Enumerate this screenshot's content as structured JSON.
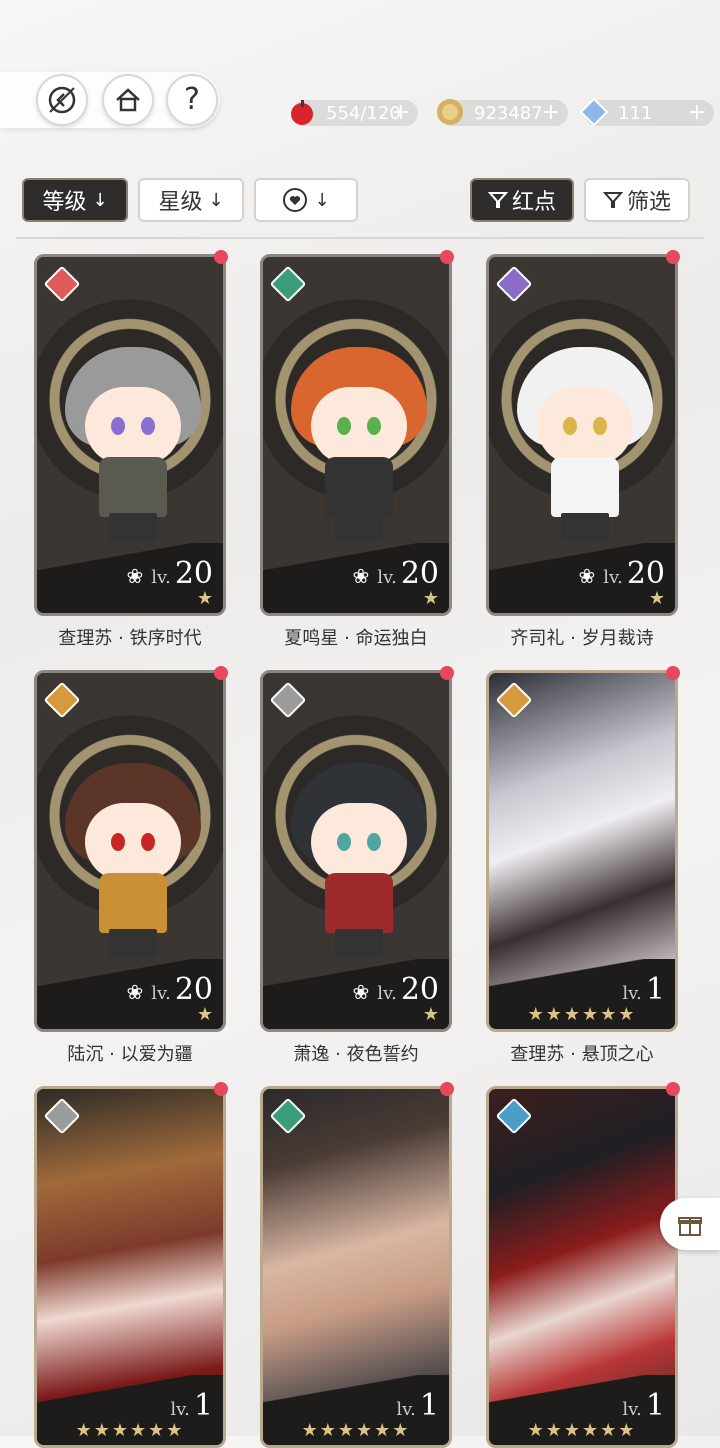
{
  "resources": [
    {
      "icon": "apple-icon",
      "value": "554/120",
      "plus": "+"
    },
    {
      "icon": "coin-icon",
      "value": "923487",
      "plus": "+"
    },
    {
      "icon": "diamond-icon",
      "value": "111",
      "plus": "+"
    }
  ],
  "top_buttons": {
    "help": "?"
  },
  "filters": {
    "level": "等级",
    "star": "星级",
    "affinity_arrow": "↓",
    "level_arrow": "↓",
    "star_arrow": "↓",
    "red_dot": "红点",
    "screen": "筛选"
  },
  "cards": [
    {
      "name": "查理苏 · 铁序时代",
      "lv_label": "lv.",
      "level": "20",
      "stars": "★",
      "element": "#e05a5a",
      "hair": "#9a9a9a",
      "eye": "#8b6fd0",
      "outfit": "#5a5a50"
    },
    {
      "name": "夏鸣星 · 命运独白",
      "lv_label": "lv.",
      "level": "20",
      "stars": "★",
      "element": "#3a9c7a",
      "hair": "#d9652f",
      "eye": "#5ab04a",
      "outfit": "#333"
    },
    {
      "name": "齐司礼 · 岁月裁诗",
      "lv_label": "lv.",
      "level": "20",
      "stars": "★",
      "element": "#8a6cc9",
      "hair": "#f1f1f1",
      "eye": "#d8b64a",
      "outfit": "#f4f4f4"
    },
    {
      "name": "陆沉 · 以爱为疆",
      "lv_label": "lv.",
      "level": "20",
      "stars": "★",
      "element": "#d49a3c",
      "hair": "#5a3528",
      "eye": "#c82525",
      "outfit": "#c99036"
    },
    {
      "name": "萧逸 · 夜色誓约",
      "lv_label": "lv.",
      "level": "20",
      "stars": "★",
      "element": "#9c9c9c",
      "hair": "#2f3338",
      "eye": "#4fa6a0",
      "outfit": "#9e2b2b"
    },
    {
      "name": "查理苏 · 悬顶之心",
      "lv_label": "lv.",
      "level": "1",
      "stars": "★★★★★★",
      "element": "#d49a3c",
      "art": "linear-gradient(160deg,#2b2d36 0%,#c9c7cf 30%,#f0eef2 45%,#3a2f33 65%,#c8c0c6 85%,#2c2a2e 100%)"
    },
    {
      "name": "",
      "lv_label": "lv.",
      "level": "1",
      "stars": "★★★★★★",
      "element": "#9c9c9c",
      "art": "linear-gradient(170deg,#2c2b27 0%,#a06a3a 25%,#7d3a2c 45%,#f0d8d0 60%,#7a1a1a 80%,#2b1d1a 100%)"
    },
    {
      "name": "",
      "lv_label": "lv.",
      "level": "1",
      "stars": "★★★★★★",
      "element": "#3a9c7a",
      "art": "linear-gradient(165deg,#2a2a2c 0%,#4a3b35 20%,#d9b7a3 45%,#c89c86 60%,#3e3e44 85%,#24211f 100%)"
    },
    {
      "name": "",
      "lv_label": "lv.",
      "level": "1",
      "stars": "★★★★★★",
      "element": "#4a9ec9",
      "art": "linear-gradient(160deg,#3c1f1f 0%,#1f1f24 25%,#8b1c1c 45%,#e8d6cf 60%,#b93636 75%,#2a2424 100%)"
    }
  ],
  "gift_icon": "gift-icon"
}
